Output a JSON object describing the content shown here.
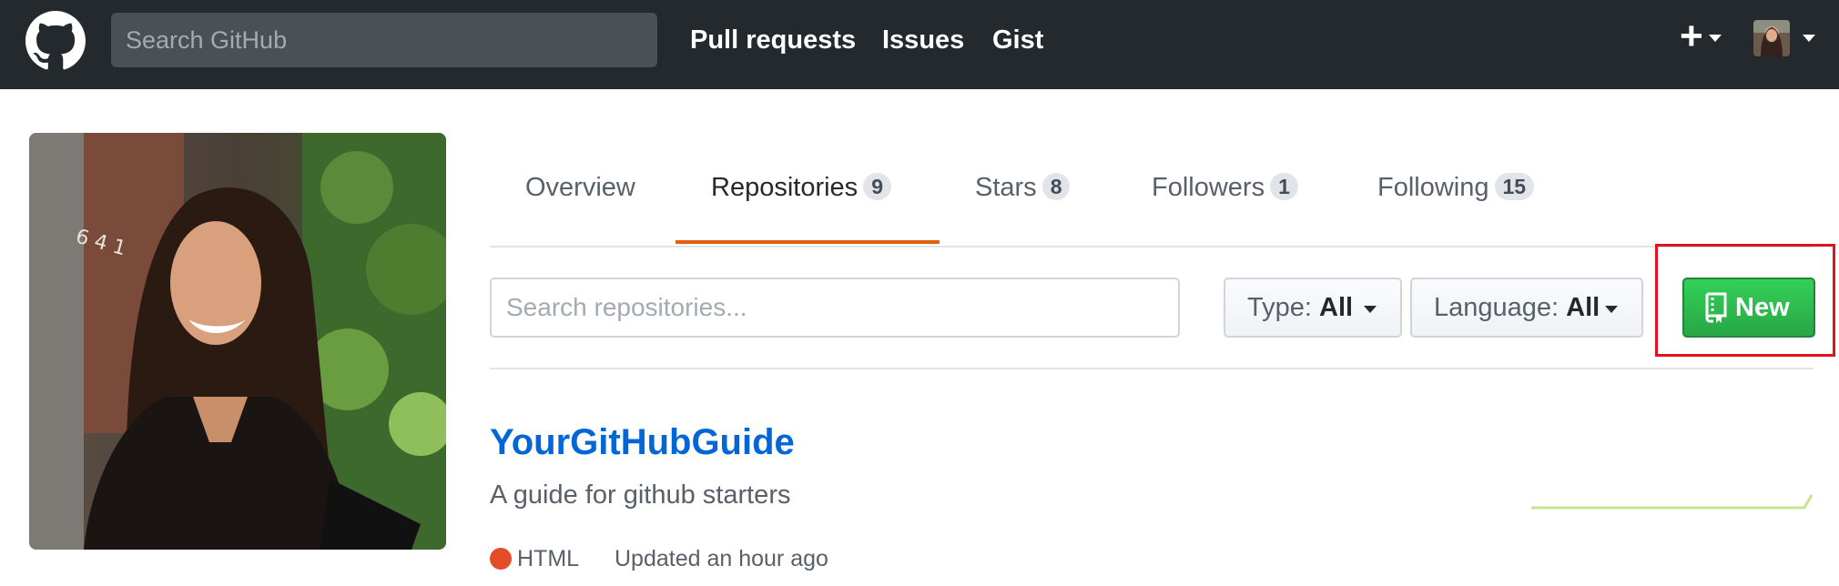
{
  "header": {
    "search_placeholder": "Search GitHub",
    "nav": [
      "Pull requests",
      "Issues",
      "Gist"
    ],
    "plus_symbol": "+"
  },
  "tabs": [
    {
      "label": "Overview",
      "count": null
    },
    {
      "label": "Repositories",
      "count": "9"
    },
    {
      "label": "Stars",
      "count": "8"
    },
    {
      "label": "Followers",
      "count": "1"
    },
    {
      "label": "Following",
      "count": "15"
    }
  ],
  "active_tab": "Repositories",
  "filters": {
    "search_placeholder": "Search repositories...",
    "type_label": "Type:",
    "type_value": "All",
    "language_label": "Language:",
    "language_value": "All",
    "new_button": "New"
  },
  "repo": {
    "name": "YourGitHubGuide",
    "description": "A guide for github starters",
    "language": "HTML",
    "language_color": "#e34c26",
    "updated": "Updated an hour ago"
  },
  "colors": {
    "header_bg": "#24292e",
    "accent_tab": "#e36209",
    "link": "#0366d6",
    "new_button": "#28a745",
    "highlight_box": "#e0131b"
  }
}
